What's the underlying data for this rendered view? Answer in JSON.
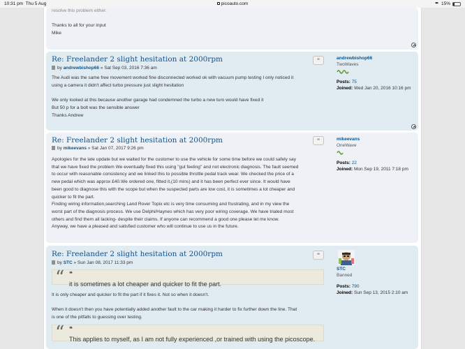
{
  "status_bar": {
    "time": "10:31 pm",
    "date": "Thu 5 Aug",
    "url": "picoauto.com",
    "battery": "15%",
    "battery_level": 0.15
  },
  "posts": [
    {
      "body_tail": [
        "resolve this problem either.",
        "",
        "Thanks to all for your input",
        "Mike"
      ]
    },
    {
      "title": "Re: Freelander 2 slight hesitation at 2000rpm",
      "by": "by",
      "author": "andrewbishop66",
      "date": "» Sat Sep 03, 2016 7:36 am",
      "body": [
        "The Audi was the same free movement worked fine disconnected worked ok with vacuum pump testing I only noticed it",
        "using a camera it didn't affect turbo pressure just slight hesitation",
        "",
        "We only looked at this because another garage had condemned the turbo a new turo would have fixed it",
        "But 50 p for a bolt was the sensible answer",
        "Thanks Andrew"
      ],
      "profile": {
        "username": "andrewbishop66",
        "rank": "TwoWaves",
        "posts_label": "Posts:",
        "posts": "75",
        "joined_label": "Joined:",
        "joined": "Wed Jan 20, 2016 10:16 pm"
      }
    },
    {
      "title": "Re: Freelander 2 slight hesitation at 2000rpm",
      "by": "by",
      "author": "mikeevans",
      "date": "» Sat Jan 07, 2017 9:26 pm",
      "body": [
        "Apologies for the late update but we waited for the customer to use the vehicle for some time before we could safely say",
        "that we have fixed the problem We eventually fixed this using \"gut feeling\" and not electronic diagnosis. The fault seemed",
        "to occur with reasonable consistency and we linked this to possible throttle pedal track wear. We checked the price of a",
        "new pedal which was approx £40.We ordered one, fitted it,(10 mins) and it has been perfect ever since. It would have",
        "been good to diagnose this with the scope but when the suspected parts are low cost, it is sometimes a lot cheaper and",
        "quicker to fit the part.",
        "Finding wiring information,searching Land Rover Topix etc is very time consuming and frustrating, and in my view the",
        "worst part of the diagnosis process. We use Delphi/Haynes which has very poor wiring coverage. We have trialed most",
        "others and find them all lacking- despite their claims. If anyone can recommend a good one please let me know.",
        "Anyway, we have a pleased and satisfied customer who will continue to use us in the future."
      ],
      "profile": {
        "username": "mikeevans",
        "rank": "OneWave",
        "posts_label": "Posts:",
        "posts": "22",
        "joined_label": "Joined:",
        "joined": "Mon Sep 19, 2011 7:18 pm"
      }
    },
    {
      "title": "Re: Freelander 2 slight hesitation at 2000rpm",
      "by": "by",
      "author": "STC",
      "date": "» Sun Jan 08, 2017 11:33 pm",
      "quote1": "it is sometimes a lot cheaper and quicker to fit the part.",
      "body": [
        "It is only cheaper and quicker to fit the part if it fixes it. Not so when it doesn't.",
        "",
        "When it doesn't then you have potentially added another fault to the car making it harder to fix further down the line. That",
        "is one of the pitfalls to guessing over testing."
      ],
      "quote2": "This applies to myself, as I am not fully experienced ,or trained with using the picoscope.",
      "profile": {
        "username": "STC",
        "rank": "Banned",
        "posts_label": "Posts:",
        "posts": "790",
        "joined_label": "Joined:",
        "joined": "Sun Sep 13, 2015 2:10 am"
      }
    }
  ],
  "quote_glyph": "“",
  "small_quote_glyph": "❝"
}
